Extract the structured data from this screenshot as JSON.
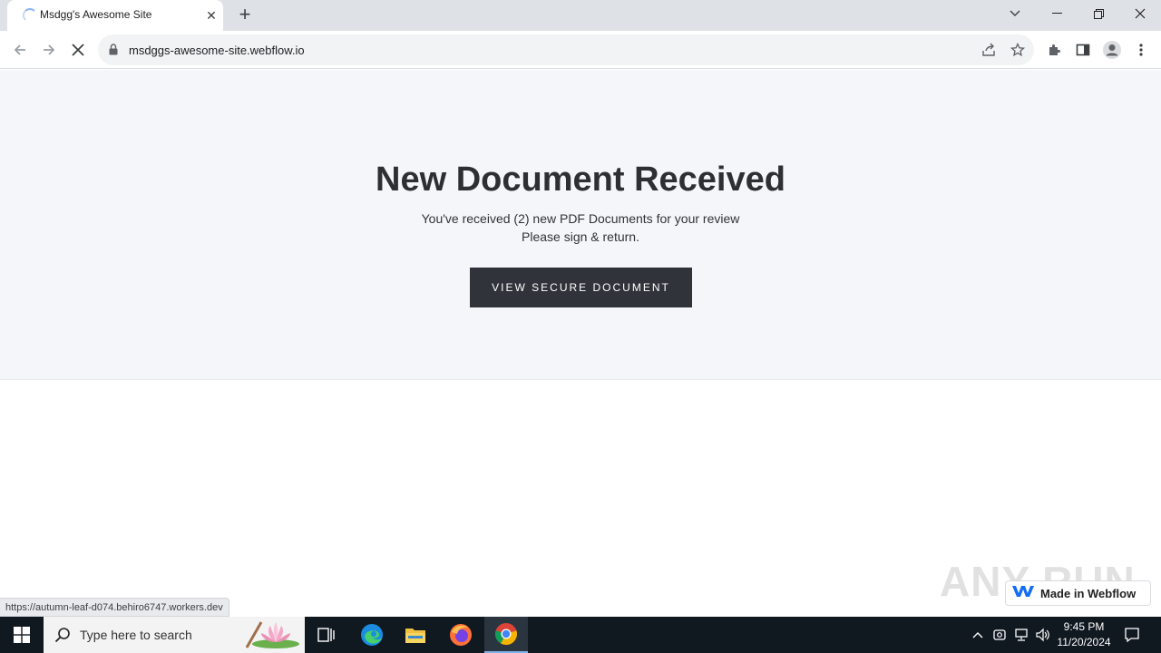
{
  "browser": {
    "tab": {
      "title": "Msdgg's Awesome Site"
    },
    "address": {
      "url": "msdggs-awesome-site.webflow.io"
    },
    "status_url": "https://autumn-leaf-d074.behiro6747.workers.dev"
  },
  "page": {
    "heading": "New Document Received",
    "line1": "You've received (2) new PDF Documents for your review",
    "line2": "Please sign & return.",
    "cta_label": "VIEW SECURE DOCUMENT",
    "badge_label": "Made in Webflow"
  },
  "watermark": "ANY RUN",
  "taskbar": {
    "search_placeholder": "Type here to search",
    "time": "9:45 PM",
    "date": "11/20/2024"
  },
  "colors": {
    "hero_bg": "#f4f6f9",
    "cta_bg": "#30333a",
    "taskbar_bg": "#101820",
    "webflow_blue": "#146ef5"
  }
}
